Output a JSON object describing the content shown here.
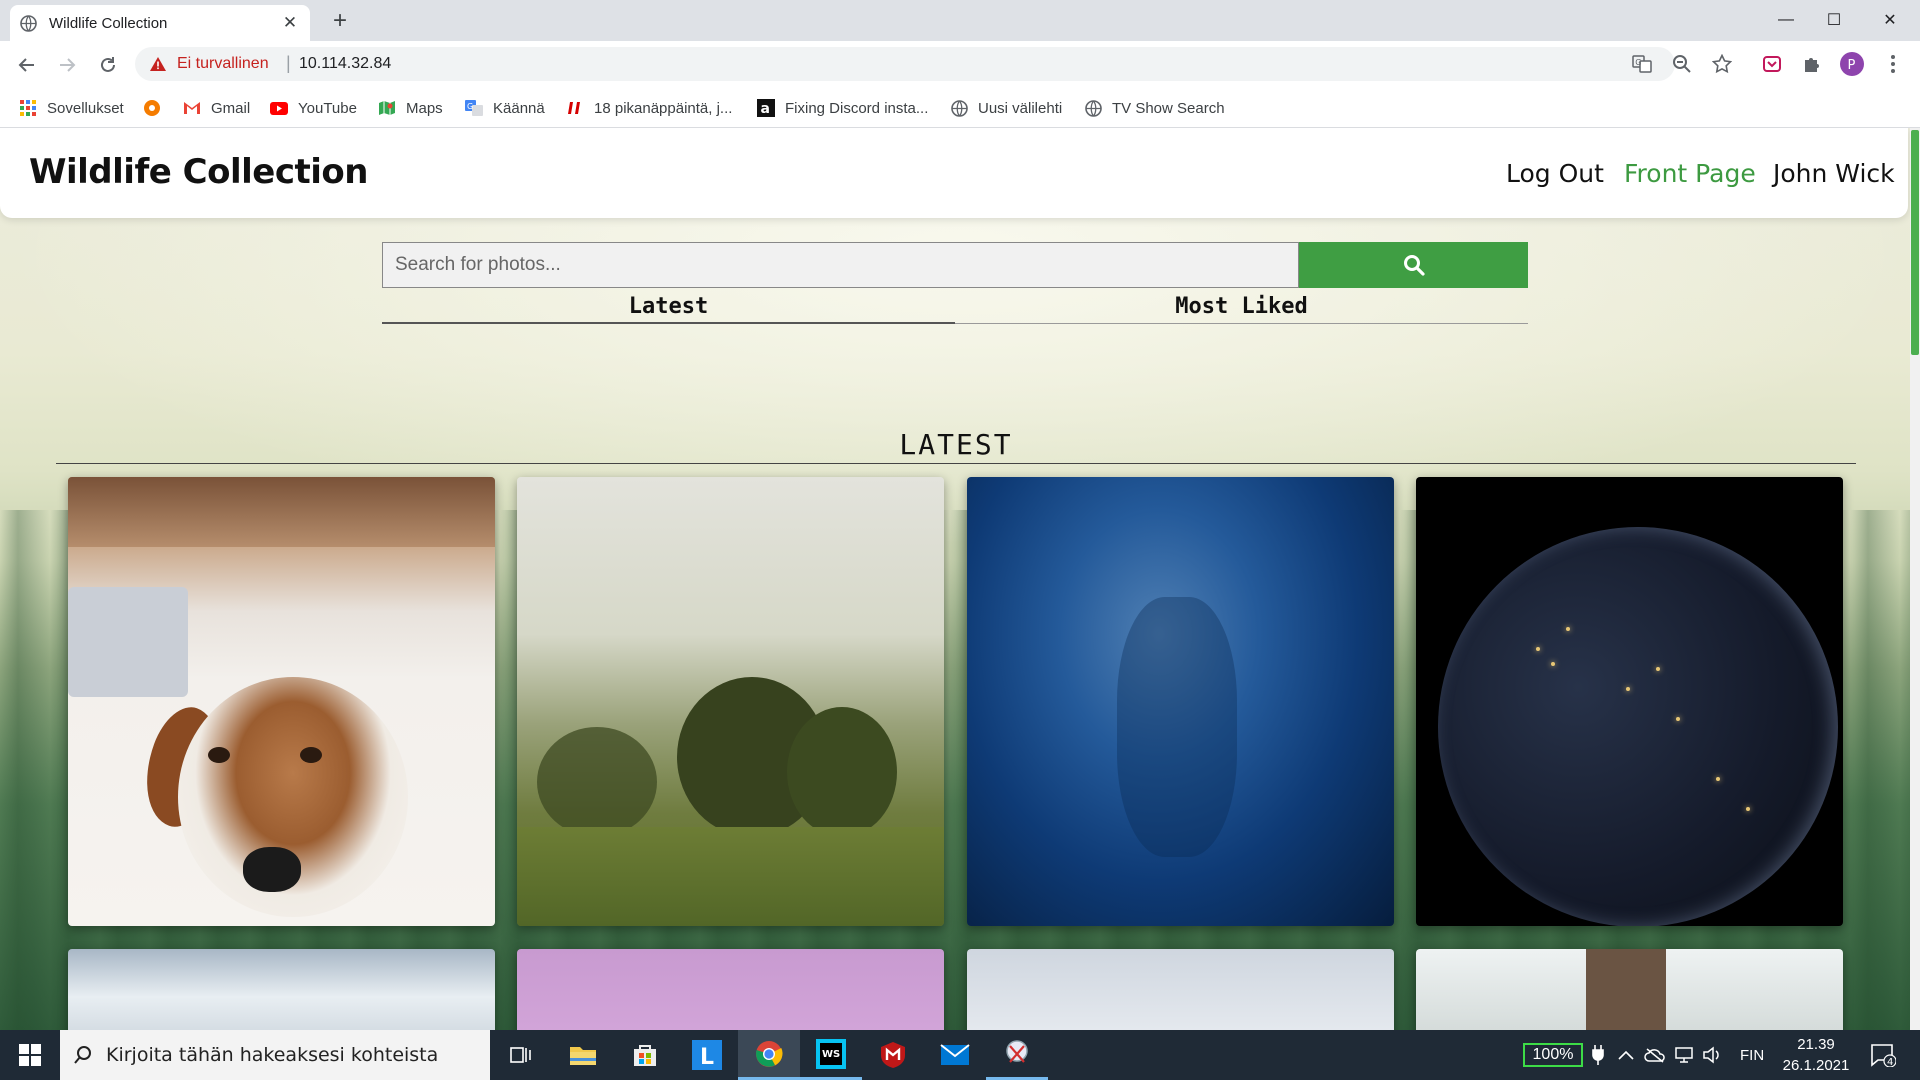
{
  "browser": {
    "tab_title": "Wildlife Collection",
    "tab_close": "✕",
    "new_tab": "+",
    "window": {
      "minimize": "—",
      "maximize": "☐",
      "close": "✕"
    },
    "security_label": "Ei turvallinen",
    "url_separator": "|",
    "url": "10.114.32.84",
    "bookmarks": [
      {
        "label": "Sovellukset",
        "icon": "apps-grid-icon"
      },
      {
        "label": "",
        "icon": "orange-circle-icon"
      },
      {
        "label": "Gmail",
        "icon": "gmail-icon"
      },
      {
        "label": "YouTube",
        "icon": "youtube-icon"
      },
      {
        "label": "Maps",
        "icon": "maps-icon"
      },
      {
        "label": "Käännä",
        "icon": "translate-icon"
      },
      {
        "label": "18 pikanäppäintä, j...",
        "icon": "il-icon"
      },
      {
        "label": "Fixing Discord insta...",
        "icon": "a-letter-icon"
      },
      {
        "label": "Uusi välilehti",
        "icon": "globe-icon"
      },
      {
        "label": "TV Show Search",
        "icon": "globe-icon"
      }
    ]
  },
  "site": {
    "title": "Wildlife Collection",
    "nav": {
      "logout": "Log Out",
      "front_page": "Front Page",
      "user": "John Wick"
    },
    "search": {
      "placeholder": "Search for photos..."
    },
    "sort_tabs": {
      "latest": "Latest",
      "most_liked": "Most Liked"
    },
    "section_title": "LATEST",
    "photos": [
      {
        "subject": "terrier dog lying on a rug"
      },
      {
        "subject": "misty landscape with trees"
      },
      {
        "subject": "dark blue textured surface"
      },
      {
        "subject": "earth at night from space"
      },
      {
        "subject": "partially visible photo"
      },
      {
        "subject": "partially visible photo"
      },
      {
        "subject": "partially visible photo"
      },
      {
        "subject": "partially visible photo"
      }
    ],
    "accent_color": "#3f9e43"
  },
  "taskbar": {
    "search_placeholder": "Kirjoita tähän hakeaksesi kohteista",
    "battery": "100%",
    "language": "FIN",
    "time": "21.39",
    "date": "26.1.2021",
    "notifications": "4"
  }
}
